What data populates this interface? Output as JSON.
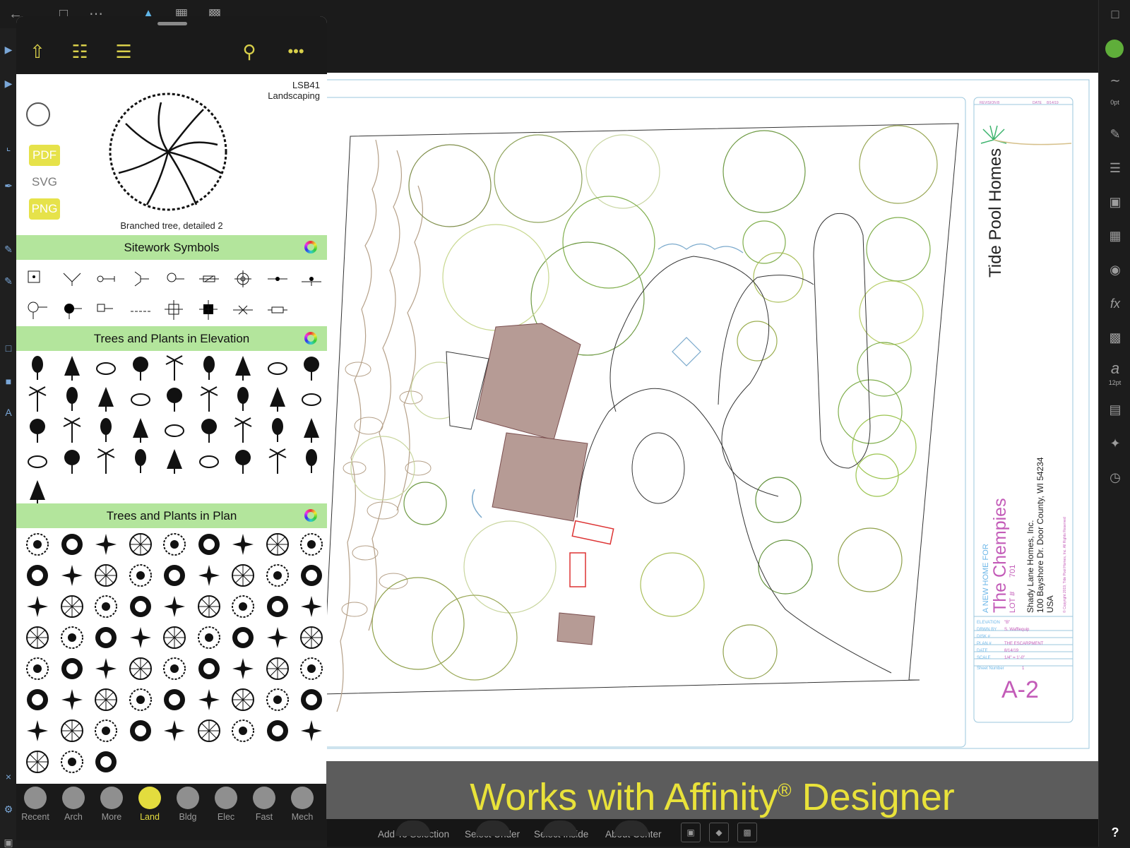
{
  "panel": {
    "symbol_id": "LSB41",
    "symbol_category": "Landscaping",
    "symbol_caption": "Branched tree, detailed 2",
    "formats": [
      "PDF",
      "SVG",
      "PNG"
    ],
    "sections": [
      {
        "title": "Sitework Symbols"
      },
      {
        "title": "Trees and Plants in Elevation"
      },
      {
        "title": "Trees and Plants in Plan"
      }
    ],
    "tabs": [
      "Recent",
      "Arch",
      "More",
      "Land",
      "Bldg",
      "Elec",
      "Fast",
      "Mech"
    ],
    "active_tab": "Land"
  },
  "drawing": {
    "project_name": "Tide Pool Homes",
    "new_home_label": "A NEW HOME FOR",
    "client": "The Chempies",
    "lot_label": "LOT #",
    "lot_number": "701",
    "builder": "Shady Lane Homes, Inc.",
    "address": "100 Bayshore Dr. Door County, WI 54234",
    "country": "USA",
    "copyright": "© Copyright 2019, Tide Pool Homes, Inc. All Rights Reserved",
    "revision_label": "REVISION",
    "revision": "B",
    "date_label": "DATE",
    "date_value": "8/14/19",
    "elevation_label": "ELEVATION",
    "elevation_value": "\"B\"",
    "drawn_label": "DRWN BY",
    "drawn_value": "S. Wafflequip",
    "disk_label": "DISK #",
    "plan_label": "PLAN #",
    "plan_value": "THE ESCARPMENT",
    "date2_label": "DATE",
    "date2_value": "8/14/19",
    "scale_label": "SCALE",
    "scale_value": "1/4\" = 1'-0\"",
    "sheet_label": "Sheet Number",
    "sheet_value": "1",
    "sheet_id": "A-2"
  },
  "banner": {
    "text_a": "Works with Affinity",
    "reg": "®",
    "text_b": " Designer"
  },
  "context_bar": {
    "items": [
      "Add To Selection",
      "Select Under",
      "Select Inside",
      "About Center"
    ]
  },
  "right_tools": {
    "stroke_width": "0pt",
    "font_size": "12pt",
    "help": "?",
    "accent_color": "#5fae3a"
  }
}
